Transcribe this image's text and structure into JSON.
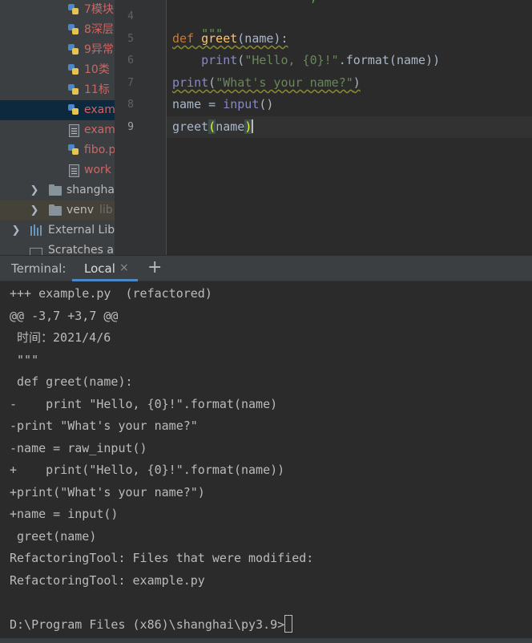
{
  "project_tree": {
    "items": [
      {
        "label": "7模块",
        "type": "py",
        "color": "red"
      },
      {
        "label": "8深层",
        "type": "py",
        "color": "red"
      },
      {
        "label": "9异常",
        "type": "py",
        "color": "red"
      },
      {
        "label": "10类",
        "type": "py",
        "color": "red"
      },
      {
        "label": "11标",
        "type": "py",
        "color": "red"
      },
      {
        "label": "exam",
        "type": "py",
        "color": "red",
        "selected": true
      },
      {
        "label": "exam",
        "type": "file",
        "color": "red"
      },
      {
        "label": "fibo.p",
        "type": "py",
        "color": "red"
      },
      {
        "label": "work",
        "type": "file",
        "color": "red"
      },
      {
        "label": "shangha",
        "type": "folder"
      },
      {
        "label": "venv",
        "suffix": "lib",
        "type": "folder"
      },
      {
        "label": "External Lib",
        "type": "lib"
      },
      {
        "label": "Scratches a",
        "type": "scratch"
      }
    ]
  },
  "editor": {
    "line_numbers": [
      "4",
      "5",
      "6",
      "7",
      "8",
      "9"
    ],
    "current_line": "9",
    "top_partial": "-- ---- -- ---- -  ,",
    "lines": {
      "l4": "\"\"\"",
      "l5_kw": "def",
      "l5_fn": "greet",
      "l5_rest": "(name):",
      "l6_indent": "    ",
      "l6_bi": "print",
      "l6_open": "(",
      "l6_str": "\"Hello, {0}!\"",
      "l6_rest": ".format(name))",
      "l7_bi": "print",
      "l7_open": "(",
      "l7_str": "\"What's your name?\"",
      "l7_close": ")",
      "l8_a": "name = ",
      "l8_bi": "input",
      "l8_b": "()",
      "l9_a": "greet",
      "l9_open": "(",
      "l9_b": "name",
      "l9_close": ")"
    }
  },
  "terminal": {
    "title": "Terminal:",
    "tab_label": "Local",
    "close_glyph": "×",
    "add_glyph": "+",
    "lines": [
      "+++ example.py  (refactored)",
      "@@ -3,7 +3,7 @@",
      " 时间：2021/4/6",
      " \"\"\"",
      " def greet(name):",
      "-    print \"Hello, {0}!\".format(name)",
      "-print \"What's your name?\"",
      "-name = raw_input()",
      "+    print(\"Hello, {0}!\".format(name))",
      "+print(\"What's your name?\")",
      "+name = input()",
      " greet(name)",
      "RefactoringTool: Files that were modified:",
      "RefactoringTool: example.py",
      "",
      "D:\\Program Files (x86)\\shanghai\\py3.9>"
    ]
  }
}
